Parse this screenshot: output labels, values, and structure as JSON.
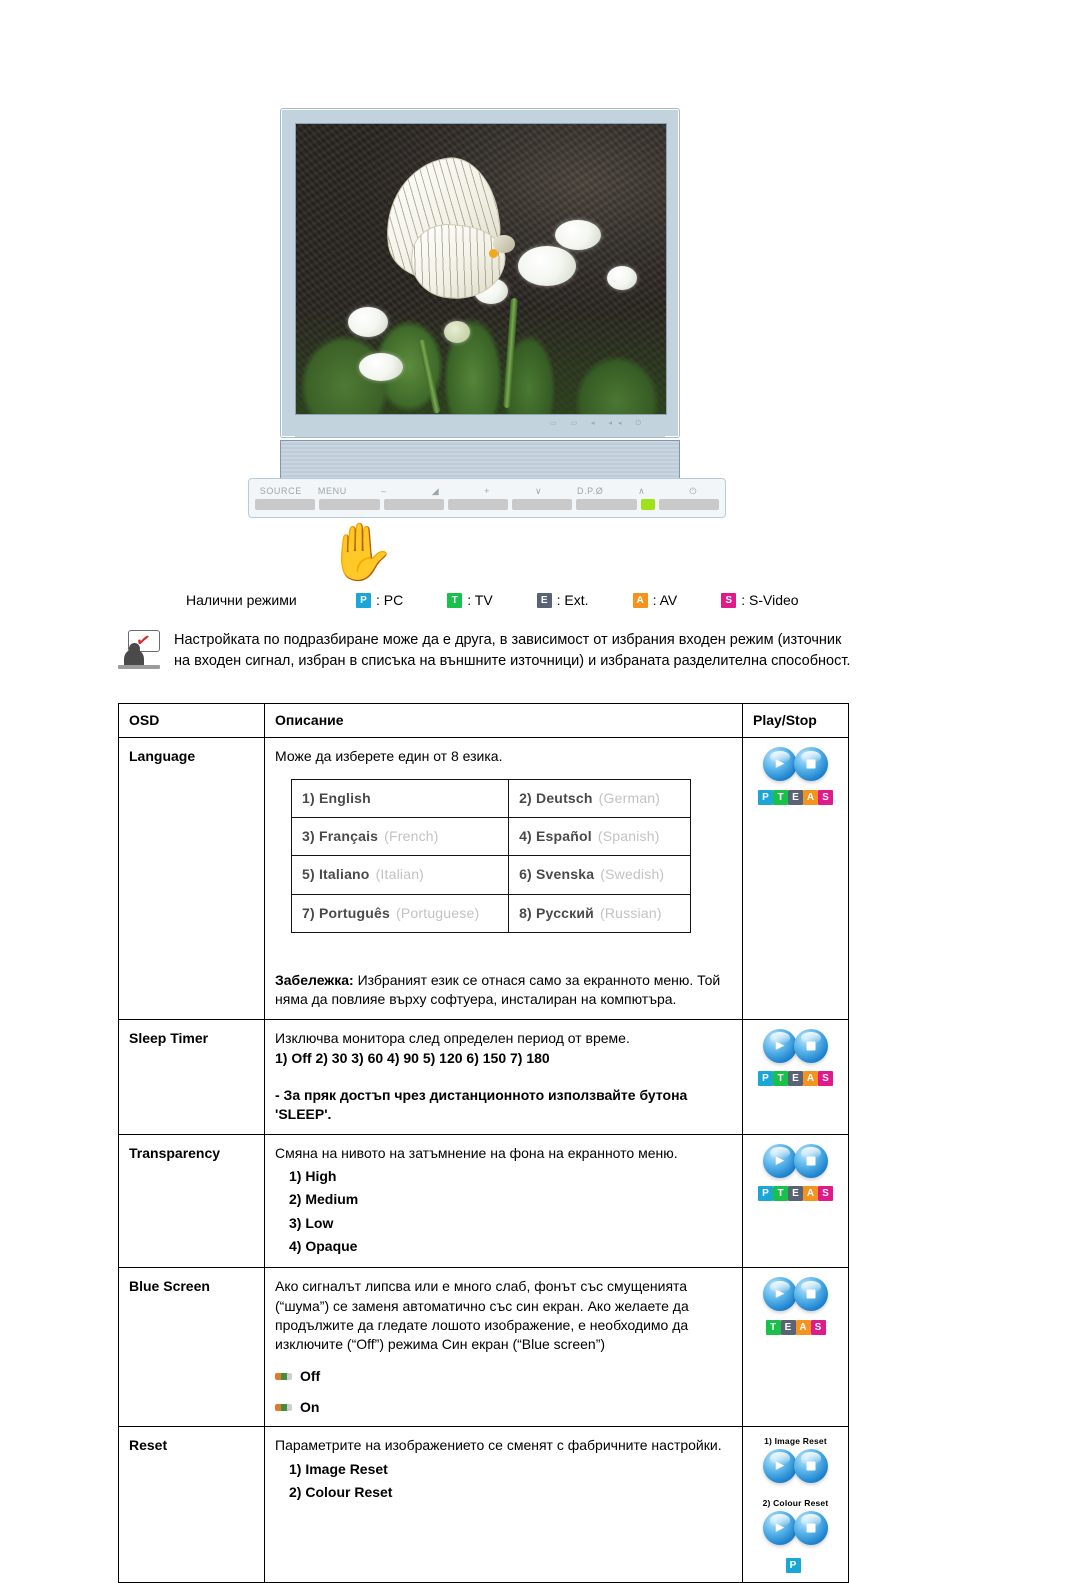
{
  "monitor": {
    "button_bar": {
      "labels": [
        "SOURCE",
        "MENU",
        "–",
        "◢",
        "+",
        "∨",
        "D.P.Ø",
        "∧",
        "⏻"
      ]
    },
    "mini_icons": "▭ ▭ ◂ ◂◂ ⏻"
  },
  "modes": {
    "label": "Налични режими",
    "items": [
      {
        "badge": "P",
        "text": ": PC",
        "color": "#1aa7d8"
      },
      {
        "badge": "T",
        "text": ": TV",
        "color": "#19c04a"
      },
      {
        "badge": "E",
        "text": ": Ext.",
        "color": "#5a6276"
      },
      {
        "badge": "A",
        "text": ": AV",
        "color": "#f4931e"
      },
      {
        "badge": "S",
        "text": ": S-Video",
        "color": "#e01a8a"
      }
    ]
  },
  "note": {
    "icon": "note-person-icon",
    "text": "Настройката по подразбиране може да е друга, в зависимост от избрания входен режим (източник на входен сигнал, избран в списъка на външните източници) и избраната разделителна способност."
  },
  "table": {
    "headers": [
      "OSD",
      "Описание",
      "Play/Stop"
    ],
    "rows": {
      "language": {
        "name": "Language",
        "desc": "Може да изберете един от 8 езика.",
        "languages": [
          {
            "n": "1)",
            "native": "English",
            "en": ""
          },
          {
            "n": "2)",
            "native": "Deutsch",
            "en": "(German)"
          },
          {
            "n": "3)",
            "native": "Français",
            "en": "(French)"
          },
          {
            "n": "4)",
            "native": "Español",
            "en": "(Spanish)"
          },
          {
            "n": "5)",
            "native": "Italiano",
            "en": "(Italian)"
          },
          {
            "n": "6)",
            "native": "Svenska",
            "en": "(Swedish)"
          },
          {
            "n": "7)",
            "native": "Português",
            "en": "(Portuguese)"
          },
          {
            "n": "8)",
            "native": "Русский",
            "en": "(Russian)"
          }
        ],
        "note_label": "Забележка:",
        "note_text": " Избраният език се отнася само за екранното меню. Той няма да повлияе върху софтуера, инсталиран на компютъра.",
        "modes": [
          "P",
          "T",
          "E",
          "A",
          "S"
        ]
      },
      "sleep_timer": {
        "name": "Sleep Timer",
        "desc": "Изключва монитора след определен период от време.",
        "options": "1) Off   2) 30   3) 60   4) 90   5) 120   6) 150   7) 180",
        "tip": "- За пряк достъп чрез дистанционното използвайте бутона 'SLEEP'.",
        "modes": [
          "P",
          "T",
          "E",
          "A",
          "S"
        ]
      },
      "transparency": {
        "name": "Transparency",
        "desc": "Смяна на нивото на затъмнение на фона на екранното меню.",
        "options": [
          "1) High",
          "2) Medium",
          "3) Low",
          "4) Opaque"
        ],
        "modes": [
          "P",
          "T",
          "E",
          "A",
          "S"
        ]
      },
      "blue_screen": {
        "name": "Blue Screen",
        "desc": "Ако сигналът липсва или е много слаб, фонът със смущенията (“шума”) се заменя автоматично със син екран. Ако желаете да продължите да гледате лошото изображение, е необходимо да изключите (“Off”) режима Син екран (“Blue screen”)",
        "radios": [
          "Off",
          "On"
        ],
        "modes": [
          "T",
          "E",
          "A",
          "S"
        ]
      },
      "reset": {
        "name": "Reset",
        "desc": "Параметрите на изображението се сменят с фабричните настройки.",
        "options": [
          "1) Image Reset",
          "2) Colour Reset"
        ],
        "captions": [
          "1) Image Reset",
          "2) Colour Reset"
        ],
        "modes": [
          "P"
        ]
      }
    }
  }
}
